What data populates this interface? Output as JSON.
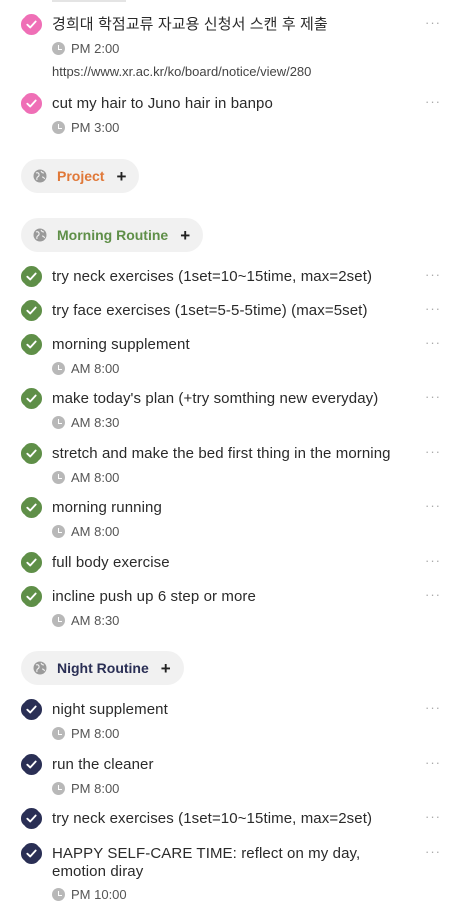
{
  "colors": {
    "pink": "#ef6fb6",
    "green": "#5f8f48",
    "navy": "#2a2f55",
    "project_label": "#e07838",
    "morning_label": "#5f8f48",
    "night_label": "#2a2f55"
  },
  "icons": {
    "check": "check-icon",
    "clock": "clock-icon",
    "globe": "globe-icon",
    "more": "more-icon",
    "plus": "plus-icon"
  },
  "tasks_top": [
    {
      "title": "경희대 학점교류 자교용 신청서 스캔 후 제출",
      "time": "PM 2:00",
      "link": "https://www.xr.ac.kr/ko/board/notice/view/280"
    },
    {
      "title": "cut my hair to Juno hair in banpo",
      "time": "PM 3:00"
    }
  ],
  "groups": {
    "project": {
      "label": "Project"
    },
    "morning": {
      "label": "Morning Routine"
    },
    "night": {
      "label": "Night Routine"
    }
  },
  "morning_tasks": [
    {
      "title": "try neck exercises (1set=10~15time, max=2set)"
    },
    {
      "title": "try face exercises (1set=5-5-5time) (max=5set)"
    },
    {
      "title": "morning supplement",
      "time": "AM 8:00"
    },
    {
      "title": "make today's plan (+try somthing new everyday)",
      "time": "AM 8:30"
    },
    {
      "title": "stretch and make the bed first thing in the morning",
      "time": "AM 8:00"
    },
    {
      "title": "morning running",
      "time": "AM 8:00"
    },
    {
      "title": "full body exercise"
    },
    {
      "title": "incline push up 6 step or more",
      "time": "AM 8:30"
    }
  ],
  "night_tasks": [
    {
      "title": "night supplement",
      "time": "PM 8:00"
    },
    {
      "title": "run the cleaner",
      "time": "PM 8:00"
    },
    {
      "title": "try neck exercises (1set=10~15time, max=2set)"
    },
    {
      "title_line1": "HAPPY SELF-CARE TIME: reflect on my day,",
      "title_line2": "emotion diray",
      "time": "PM 10:00"
    }
  ],
  "more_glyph": "···",
  "plus_glyph": "+"
}
